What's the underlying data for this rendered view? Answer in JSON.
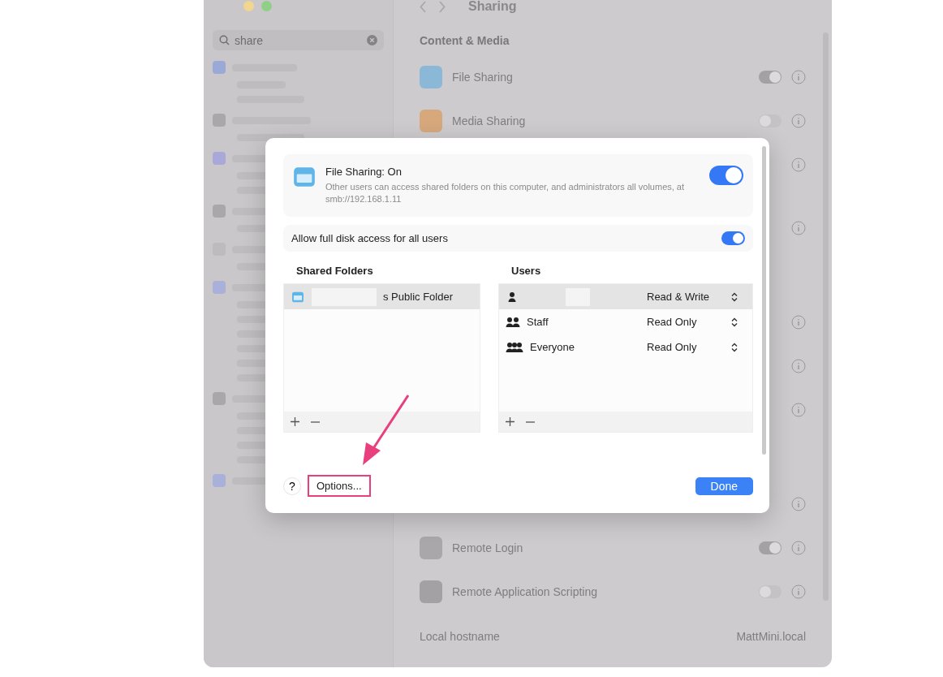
{
  "window": {
    "title": "Sharing",
    "traffic_lights": [
      {
        "color": "#f2d58e"
      },
      {
        "color": "#8fcf8a"
      }
    ]
  },
  "search": {
    "value": "share"
  },
  "sidebar": {
    "groups": [
      {
        "color": "#9aa9d6"
      },
      {
        "color": "#a9a7a9"
      },
      {
        "color": "#a9a8d9"
      },
      {
        "color": "#a9a7a9"
      },
      {
        "color": "#bdbbbd"
      },
      {
        "color": "#a9b0d9"
      },
      {
        "color": "#a9a7a9"
      },
      {
        "color": "#a9b0d9"
      }
    ]
  },
  "main": {
    "section": "Content & Media",
    "rows": [
      {
        "kind": "item",
        "label": "File Sharing",
        "on": true
      },
      {
        "kind": "item",
        "label": "Media Sharing",
        "on": false
      },
      {
        "kind": "covered"
      },
      {
        "kind": "gap"
      },
      {
        "kind": "covered"
      },
      {
        "kind": "gap"
      },
      {
        "kind": "covered"
      },
      {
        "kind": "covered"
      },
      {
        "kind": "covered"
      },
      {
        "kind": "gap"
      },
      {
        "kind": "covered"
      },
      {
        "kind": "item",
        "label": "Remote Login",
        "on": true
      },
      {
        "kind": "item",
        "label": "Remote Application Scripting",
        "on": false
      }
    ],
    "hostname": {
      "label": "Local hostname",
      "value": "MattMini.local"
    }
  },
  "dialog": {
    "title": "File Sharing: On",
    "description": "Other users can access shared folders on this computer, and administrators all volumes, at smb://192.168.1.11",
    "on": true,
    "full_disk": {
      "label": "Allow full disk access for all users",
      "on": true
    },
    "folders": {
      "heading": "Shared Folders",
      "items": [
        {
          "name": "s Public Folder",
          "selected": true
        }
      ]
    },
    "users": {
      "heading": "Users",
      "items": [
        {
          "kind": "person",
          "access": "Read & Write",
          "selected": true
        },
        {
          "kind": "group",
          "name": "Staff",
          "access": "Read Only",
          "selected": false
        },
        {
          "kind": "everyone",
          "name": "Everyone",
          "access": "Read Only",
          "selected": false
        }
      ]
    },
    "help": "?",
    "options": "Options...",
    "done": "Done"
  }
}
